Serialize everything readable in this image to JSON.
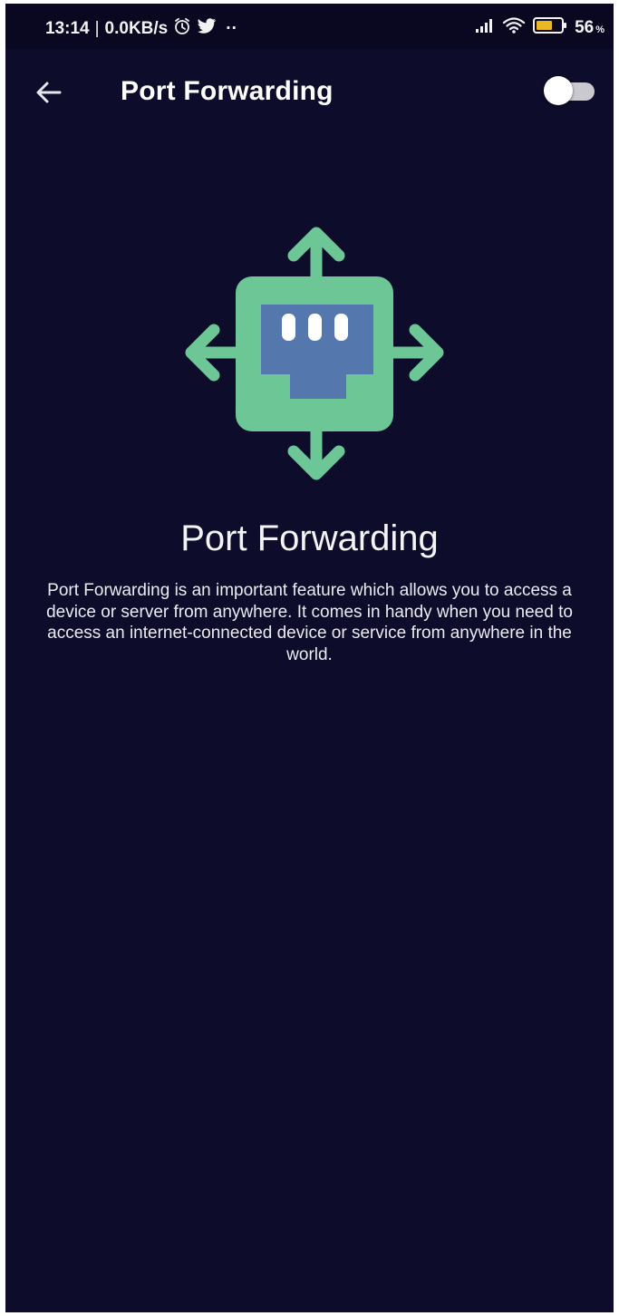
{
  "status_bar": {
    "time": "13:14",
    "separator": "|",
    "net_speed": "0.0KB/s",
    "dots": "··",
    "battery_percent": "56",
    "battery_percent_sign": "%",
    "icons": [
      "alarm-icon",
      "twitter-icon",
      "signal-icon",
      "wifi-icon",
      "battery-icon"
    ]
  },
  "app_bar": {
    "title": "Port Forwarding",
    "back_icon": "arrow-left-icon",
    "toggle_on": false
  },
  "content": {
    "heading": "Port Forwarding",
    "description": "Port Forwarding is an important feature which allows you to access a device or server from anywhere. It comes in handy when you need to access an internet-connected device or service from anywhere in the world."
  },
  "colors": {
    "background": "#0d0c2a",
    "status_bar": "#090820",
    "accent_green": "#6cc695",
    "port_blue": "#5477ad",
    "battery_yellow": "#e8b825"
  }
}
